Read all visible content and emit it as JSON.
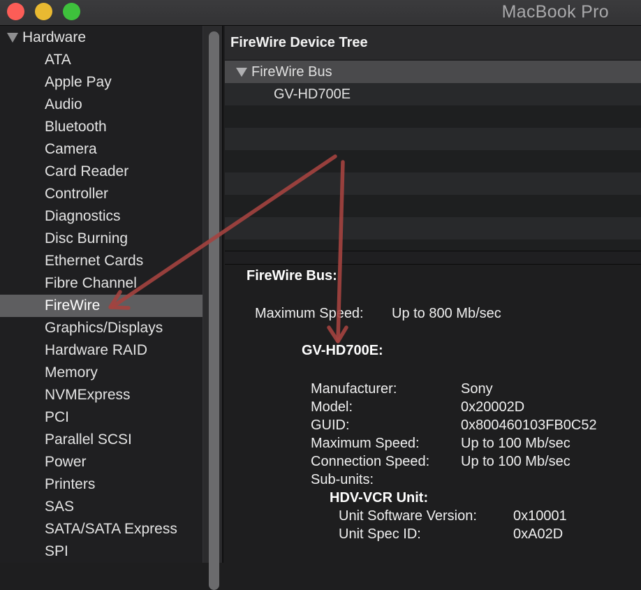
{
  "window": {
    "title": "MacBook Pro",
    "controls": [
      "close",
      "minimize",
      "zoom"
    ]
  },
  "sidebar": {
    "group": {
      "label": "Hardware",
      "expanded": true
    },
    "items": [
      {
        "label": "ATA"
      },
      {
        "label": "Apple Pay"
      },
      {
        "label": "Audio"
      },
      {
        "label": "Bluetooth"
      },
      {
        "label": "Camera"
      },
      {
        "label": "Card Reader"
      },
      {
        "label": "Controller"
      },
      {
        "label": "Diagnostics"
      },
      {
        "label": "Disc Burning"
      },
      {
        "label": "Ethernet Cards"
      },
      {
        "label": "Fibre Channel"
      },
      {
        "label": "FireWire",
        "selected": true
      },
      {
        "label": "Graphics/Displays"
      },
      {
        "label": "Hardware RAID"
      },
      {
        "label": "Memory"
      },
      {
        "label": "NVMExpress"
      },
      {
        "label": "PCI"
      },
      {
        "label": "Parallel SCSI"
      },
      {
        "label": "Power"
      },
      {
        "label": "Printers"
      },
      {
        "label": "SAS"
      },
      {
        "label": "SATA/SATA Express"
      },
      {
        "label": "SPI"
      }
    ]
  },
  "tree": {
    "title": "FireWire Device Tree",
    "bus": {
      "label": "FireWire Bus",
      "expanded": true
    },
    "device": {
      "label": "GV-HD700E"
    }
  },
  "details": {
    "bus_heading": "FireWire Bus:",
    "bus_max_speed_label": "Maximum Speed:",
    "bus_max_speed_value": "Up to 800 Mb/sec",
    "device_heading": "GV-HD700E:",
    "fields": [
      {
        "label": "Manufacturer:",
        "value": "Sony"
      },
      {
        "label": "Model:",
        "value": "0x20002D"
      },
      {
        "label": "GUID:",
        "value": "0x800460103FB0C52"
      },
      {
        "label": "Maximum Speed:",
        "value": "Up to 100 Mb/sec"
      },
      {
        "label": "Connection Speed:",
        "value": "Up to 100 Mb/sec"
      },
      {
        "label": "Sub-units:",
        "value": ""
      }
    ],
    "subunit": {
      "heading": "HDV-VCR Unit:",
      "fields": [
        {
          "label": "Unit Software Version:",
          "value": "0x10001"
        },
        {
          "label": "Unit Spec ID:",
          "value": "0xA02D"
        }
      ]
    }
  },
  "annotations": {
    "arrow_color": "#a4423f",
    "arrows": [
      {
        "from": "tree-pane",
        "to": "sidebar-item-firewire"
      },
      {
        "from": "tree-pane",
        "to": "device-heading"
      }
    ]
  }
}
